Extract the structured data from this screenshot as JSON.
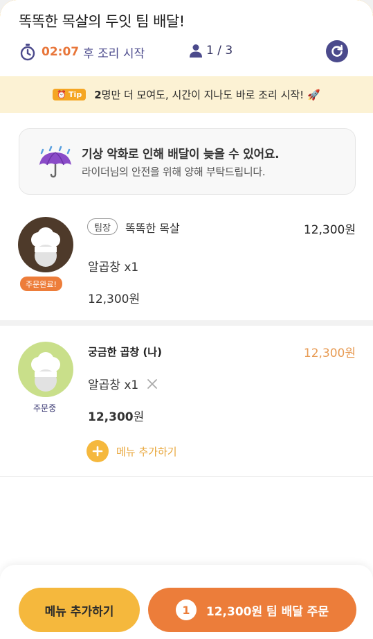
{
  "header": {
    "title": "똑똑한 목살의 두잇 팀 배달!",
    "timer_time": "02:07",
    "timer_label": "후 조리 시작",
    "people_count": "1 / 3"
  },
  "tip": {
    "badge": "Tip",
    "count": "2",
    "text": "명만 더 모여도, 시간이 지나도 바로 조리 시작! 🚀"
  },
  "notice": {
    "title": "기상 악화로 인해 배달이 늦을 수 있어요.",
    "subtitle": "라이더님의 안전을 위해 양해 부탁드립니다."
  },
  "members": [
    {
      "tag": "팀장",
      "name": "똑똑한 목살",
      "price": "12,300원",
      "item": "알곱창 x1",
      "subtotal": "12,300원",
      "status": "주문완료!"
    },
    {
      "name": "궁금한 곱창 (나)",
      "price": "12,300원",
      "item": "알곱창 x1",
      "subtotal_num": "12,300",
      "subtotal_unit": "원",
      "status": "주문중",
      "add_menu_label": "메뉴 추가하기"
    }
  ],
  "footer": {
    "add_button": "메뉴 추가하기",
    "order_count": "1",
    "order_button": "12,300원 팀 배달 주문"
  },
  "colors": {
    "accent_orange": "#ec7d3a",
    "accent_yellow": "#f5b83d",
    "navy": "#4b4a8c",
    "tip_bg": "#fcf2d4"
  }
}
